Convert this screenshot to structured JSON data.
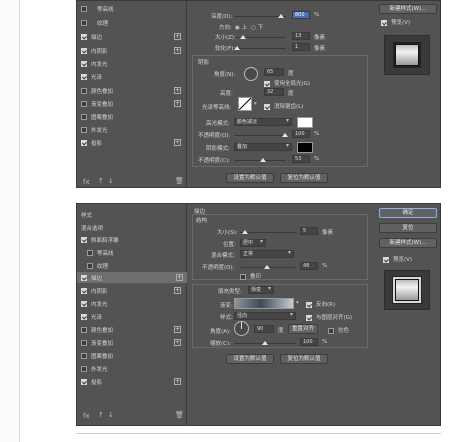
{
  "panel1": {
    "left_items": [
      {
        "label": "等高线",
        "checked": false
      },
      {
        "label": "纹理",
        "checked": false
      },
      {
        "label": "描边",
        "checked": true,
        "plus": true
      },
      {
        "label": "内阴影",
        "checked": true,
        "plus": true
      },
      {
        "label": "内发光",
        "checked": true
      },
      {
        "label": "光泽",
        "checked": true
      },
      {
        "label": "颜色叠加",
        "checked": false,
        "plus": true
      },
      {
        "label": "渐变叠加",
        "checked": false,
        "plus": true
      },
      {
        "label": "图案叠加",
        "checked": false
      },
      {
        "label": "外发光",
        "checked": false
      },
      {
        "label": "投影",
        "checked": true,
        "plus": true
      }
    ],
    "bottom_icons": [
      "fx",
      "↑",
      "↓"
    ],
    "depth_label": "深度(D):",
    "depth_value": "800",
    "depth_unit": "%",
    "direction_label": "方向:",
    "dir_up": "上",
    "dir_down": "下",
    "size_label": "大小(Z):",
    "size_value": "13",
    "size_unit": "像素",
    "soften_label": "软化(F):",
    "soften_value": "1",
    "soften_unit": "像素",
    "shading_title": "阴影",
    "angle_label": "角度(N):",
    "angle_value": "65",
    "angle_unit": "度",
    "global_light_label": "使用全局光(G)",
    "altitude_label": "高度:",
    "altitude_value": "32",
    "altitude_unit": "度",
    "gloss_label": "光泽等高线:",
    "antialias_label": "消除锯齿(L)",
    "highlight_label": "高光模式:",
    "highlight_mode": "颜色减淡",
    "opacity1_label": "不透明度(O):",
    "opacity1_value": "100",
    "opacity1_unit": "%",
    "shadow_label": "阴影模式:",
    "shadow_mode": "叠加",
    "opacity2_label": "不透明度(C):",
    "opacity2_value": "53",
    "opacity2_unit": "%",
    "set_default": "设置为默认值",
    "reset_default": "复位为默认值",
    "new_style": "新建样式(W)...",
    "preview_label": "预览(V)",
    "highlight_color": "#ffffff",
    "shadow_color": "#000000"
  },
  "panel2": {
    "left_items": [
      {
        "label": "样式",
        "type": "header"
      },
      {
        "label": "混合选项",
        "type": "header"
      },
      {
        "label": "斜面和浮雕",
        "checked": true
      },
      {
        "label": "等高线",
        "checked": false,
        "indent": true
      },
      {
        "label": "纹理",
        "checked": false,
        "indent": true
      },
      {
        "label": "描边",
        "checked": true,
        "plus": true,
        "selected": true
      },
      {
        "label": "内阴影",
        "checked": true,
        "plus": true
      },
      {
        "label": "内发光",
        "checked": true
      },
      {
        "label": "光泽",
        "checked": true
      },
      {
        "label": "颜色叠加",
        "checked": false,
        "plus": true
      },
      {
        "label": "渐变叠加",
        "checked": false,
        "plus": true
      },
      {
        "label": "图案叠加",
        "checked": false
      },
      {
        "label": "外发光",
        "checked": false
      },
      {
        "label": "投影",
        "checked": true,
        "plus": true
      }
    ],
    "bottom_icons": [
      "fx",
      "↑",
      "↓"
    ],
    "section_title": "描边",
    "structure_title": "结构",
    "size_label": "大小(S):",
    "size_value": "5",
    "size_unit": "像素",
    "position_label": "位置:",
    "position_value": "居中",
    "blend_label": "混合模式:",
    "blend_value": "正常",
    "opacity_label": "不透明度(O):",
    "opacity_value": "48",
    "opacity_unit": "%",
    "overprint_label": "叠印",
    "fill_type_label": "填充类型:",
    "fill_type_value": "渐变",
    "gradient_label": "渐变:",
    "reverse_label": "反向(R)",
    "style_label": "样式:",
    "style_value": "径向",
    "align_label": "与图层对齐(G)",
    "angle_label": "角度(A):",
    "angle_value": "90",
    "angle_unit": "度",
    "reset_align": "重置对齐",
    "dither_label": "仿色",
    "scale_label": "缩放(C):",
    "scale_value": "100",
    "scale_unit": "%",
    "set_default": "设置为默认值",
    "reset_default": "复位为默认值",
    "ok": "确定",
    "cancel": "复位",
    "new_style": "新建样式(W)...",
    "preview_label": "预览(V)"
  }
}
